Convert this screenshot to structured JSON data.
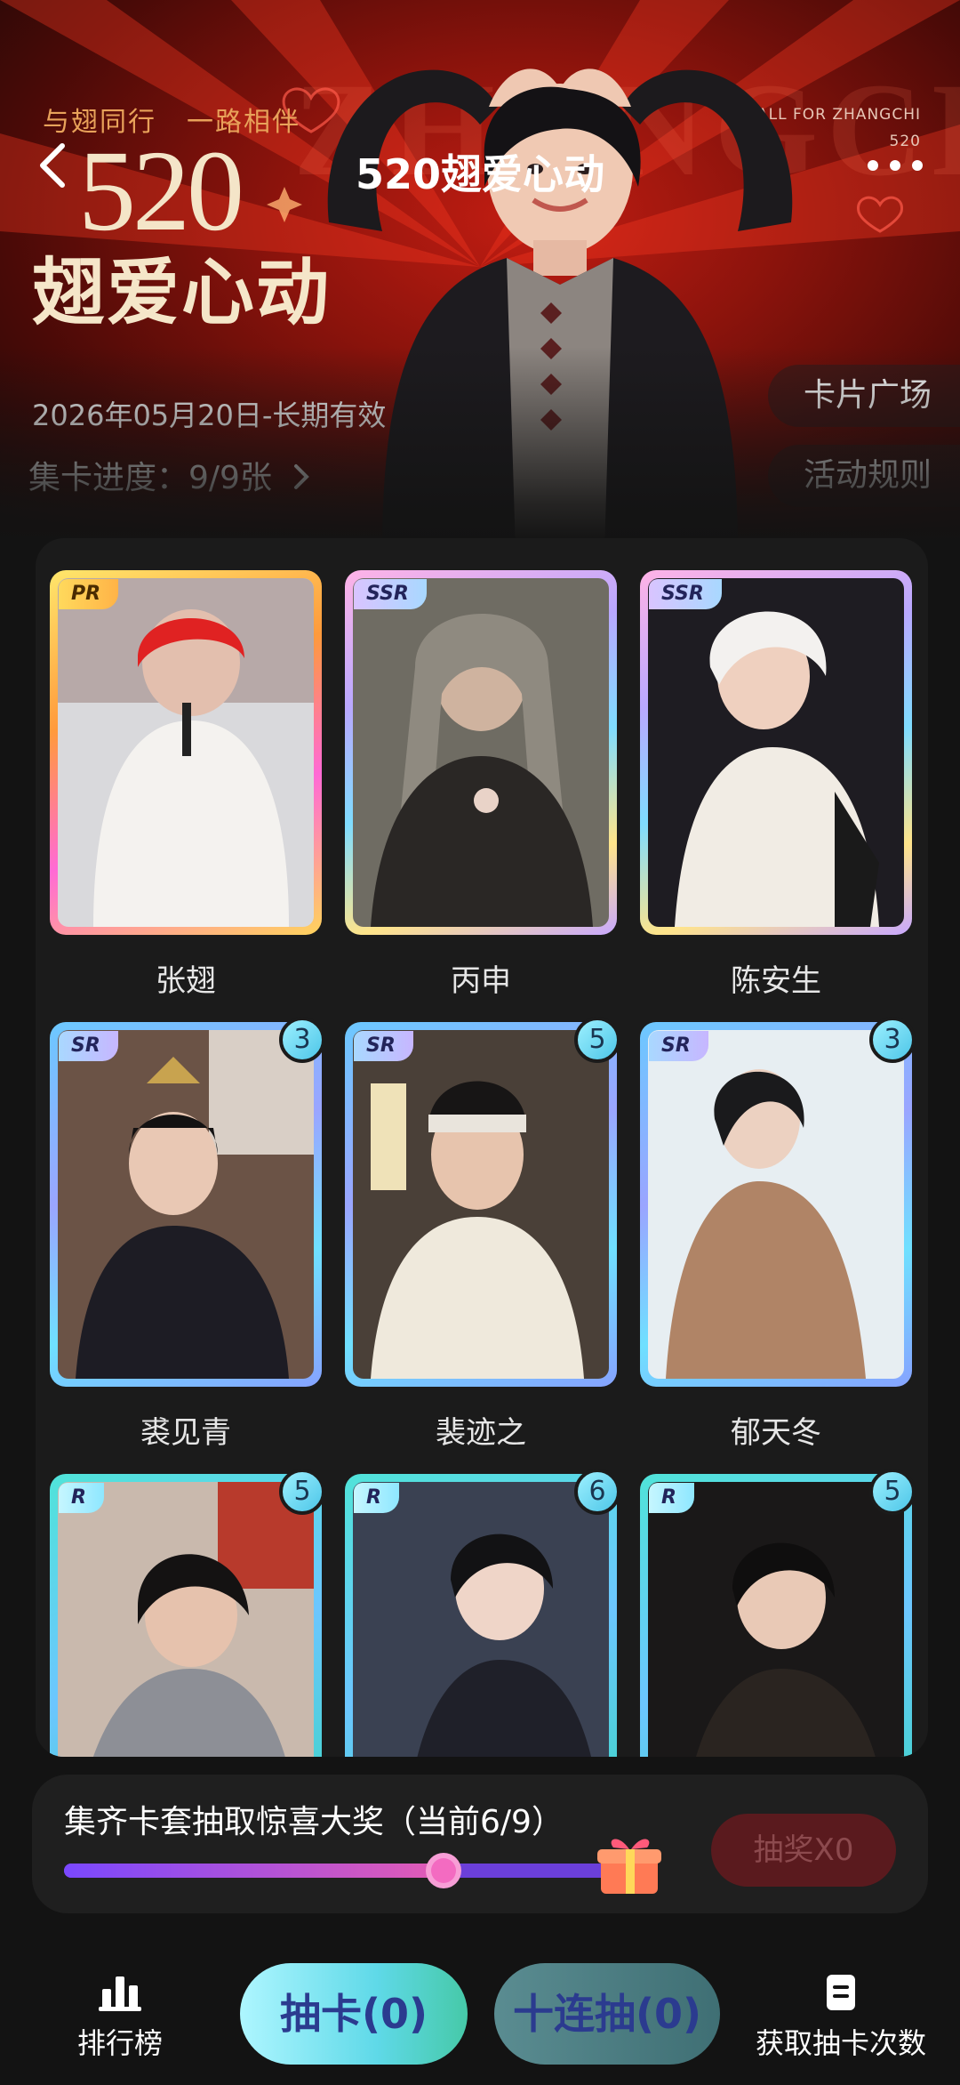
{
  "header": {
    "nav_title": "520翅爱心动",
    "slogan_left": "与翅同行",
    "slogan_right": "一路相伴",
    "big_number": "520",
    "big_title": "翅爱心动",
    "tagline_line1": "ALL FOR ZHANGCHI",
    "tagline_line2": "520",
    "date_range": "2026年05月20日-长期有效",
    "progress_label": "集卡进度：9/9张",
    "card_plaza": "卡片广场",
    "event_rules": "活动规则"
  },
  "cards": [
    {
      "name": "张翅",
      "tier": "PR",
      "count": ""
    },
    {
      "name": "丙申",
      "tier": "SSR",
      "count": ""
    },
    {
      "name": "陈安生",
      "tier": "SSR",
      "count": ""
    },
    {
      "name": "裘见青",
      "tier": "SR",
      "count": "3"
    },
    {
      "name": "裴迹之",
      "tier": "SR",
      "count": "5"
    },
    {
      "name": "郁天冬",
      "tier": "SR",
      "count": "3"
    },
    {
      "name": "",
      "tier": "R",
      "count": "5"
    },
    {
      "name": "",
      "tier": "R",
      "count": "6"
    },
    {
      "name": "",
      "tier": "R",
      "count": "5"
    }
  ],
  "prize": {
    "text": "集齐卡套抽取惊喜大奖（当前6/9）",
    "progress_fraction": 0.667,
    "lottery_button": "抽奖X0"
  },
  "bottom": {
    "ranking": "排行榜",
    "draw": "抽卡(0)",
    "draw_ten": "十连抽(0)",
    "get_draws": "获取抽卡次数"
  },
  "colors": {
    "accent_cyan": "#5fd9e8",
    "hero_red": "#c21d12",
    "progress_purple": "#7a48ff",
    "progress_pink": "#e35bb5"
  },
  "icons": [
    "back-arrow-icon",
    "more-dots-icon",
    "chevron-right-icon",
    "ranking-icon",
    "document-icon",
    "gift-icon"
  ]
}
